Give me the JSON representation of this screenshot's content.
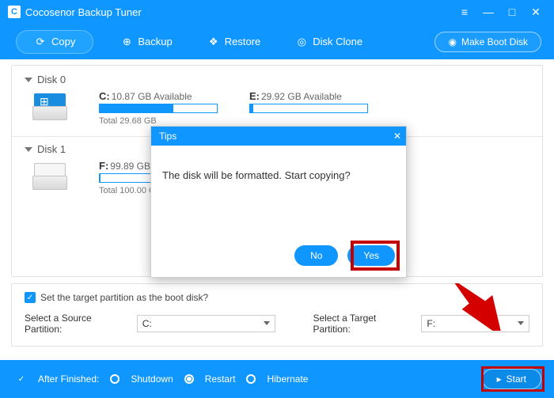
{
  "app": {
    "title": "Cocosenor Backup Tuner"
  },
  "window_buttons": {
    "menu": "≡",
    "minimize": "—",
    "maximize": "□",
    "close": "✕"
  },
  "toolbar": {
    "copy": {
      "label": "Copy",
      "icon": "⟳"
    },
    "backup": {
      "label": "Backup",
      "icon": "⊕"
    },
    "restore": {
      "label": "Restore",
      "icon": "❖"
    },
    "clone": {
      "label": "Disk Clone",
      "icon": "◎"
    },
    "bootdisk": {
      "label": "Make Boot Disk",
      "icon": "◉"
    }
  },
  "disks": {
    "d0": {
      "title": "Disk 0",
      "parts": [
        {
          "letter": "C:",
          "avail": "10.87 GB Available",
          "total": "Total 29.68 GB",
          "usedPct": 63
        },
        {
          "letter": "E:",
          "avail": "29.92 GB Available",
          "total": "",
          "usedPct": 3
        }
      ]
    },
    "d1": {
      "title": "Disk 1",
      "parts": [
        {
          "letter": "F:",
          "avail": "99.89 GB Available",
          "total": "Total 100.00 GB",
          "usedPct": 1
        }
      ]
    }
  },
  "options": {
    "boot_checkbox": "Set the target partition as the boot disk?",
    "source_label": "Select a Source Partition:",
    "target_label": "Select a Target Partition:",
    "source_value": "C:",
    "target_value": "F:"
  },
  "footer": {
    "after_label": "After Finished:",
    "shutdown": "Shutdown",
    "restart": "Restart",
    "hibernate": "Hibernate",
    "start": "Start",
    "selected": "restart"
  },
  "modal": {
    "title": "Tips",
    "message": "The disk will be formatted. Start copying?",
    "no": "No",
    "yes": "Yes"
  }
}
